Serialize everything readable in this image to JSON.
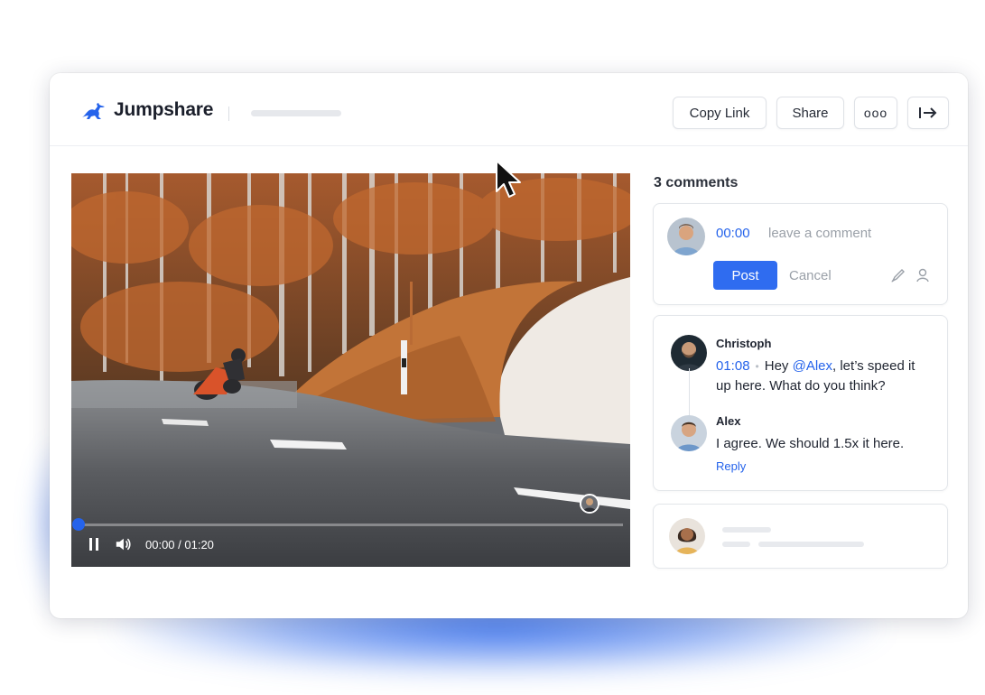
{
  "app": {
    "brand": "Jumpshare"
  },
  "header": {
    "copy_link_label": "Copy Link",
    "share_label": "Share",
    "more_label": "ooo"
  },
  "video": {
    "time_display": "00:00 / 01:20",
    "progress_fraction": 0.0
  },
  "comments": {
    "count_label": "3 comments",
    "compose": {
      "timestamp": "00:00",
      "placeholder": "leave a comment",
      "post_label": "Post",
      "cancel_label": "Cancel"
    },
    "thread": [
      {
        "author": "Christoph",
        "timestamp": "01:08",
        "text_before": "Hey ",
        "mention": "@Alex",
        "text_after": ", let’s speed it up here. What do you think?"
      },
      {
        "author": "Alex",
        "text": "I agree. We should 1.5x it here.",
        "reply_label": "Reply"
      }
    ]
  },
  "colors": {
    "accent": "#2563eb",
    "post_button": "#2f6cf0",
    "muted_text": "#9aa0a8"
  },
  "icons": {
    "logo": "kangaroo-icon",
    "exit": "exit-arrow-icon",
    "pause": "pause-icon",
    "volume": "volume-icon",
    "pen": "pen-icon",
    "user": "user-icon",
    "cursor": "mouse-pointer-icon"
  }
}
